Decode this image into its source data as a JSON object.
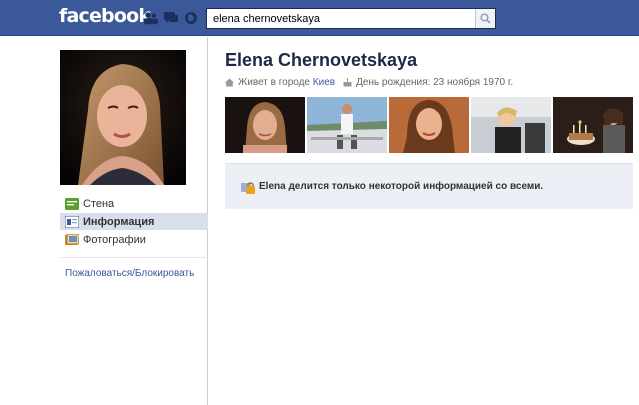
{
  "header": {
    "logo_text": "facebook",
    "search_value": "elena chernovetskaya",
    "icons": [
      "friends-icon",
      "messages-icon",
      "notifications-icon",
      "search-icon"
    ]
  },
  "sidebar": {
    "items": [
      {
        "label": "Стена",
        "icon": "wall-icon"
      },
      {
        "label": "Информация",
        "icon": "info-icon",
        "selected": true
      },
      {
        "label": "Фотографии",
        "icon": "photos-icon"
      }
    ],
    "report_label": "Пожаловаться/Блокировать"
  },
  "profile": {
    "name": "Elena Chernovetskaya",
    "lives_prefix": "Живет в городе",
    "city": "Киев",
    "birthday": "День рождения: 23 ноября 1970 г."
  },
  "notice": {
    "text": "Elena делится только некоторой информацией со всеми."
  },
  "colors": {
    "brand": "#3b5998",
    "selected_bg": "#d8dfea",
    "notice_bg": "#eceff5"
  }
}
